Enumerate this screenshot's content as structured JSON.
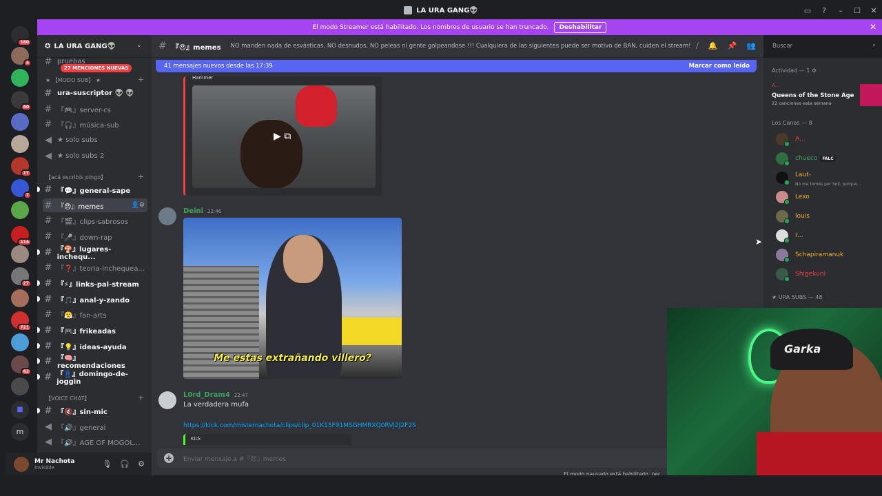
{
  "window": {
    "title": "LA URA GANG👽"
  },
  "streamer_bar": {
    "message": "El modo Streamer está habilitado. Los nombres de usuario se han truncado.",
    "button": "Deshabilitar"
  },
  "server_badges": [
    "160",
    "5",
    "80",
    "",
    "",
    "17",
    "7",
    "",
    "114",
    "",
    "27",
    "",
    "721",
    "",
    "62",
    "",
    ""
  ],
  "guild": {
    "name": "LA URA GANG👽",
    "mentions": "27 MENCIONES NUEVAS"
  },
  "categories": {
    "modo_sub": "【MODO SUB】",
    "aca": "【acá escribís pingo】",
    "voice": "【VOICE CHAT】"
  },
  "channels": [
    {
      "name": "pruebas"
    },
    {
      "name": "ura-suscriptor 👽 👽"
    },
    {
      "name": "『🎮』server-cs"
    },
    {
      "name": "『🎧』música-sub"
    },
    {
      "name": "★ solo subs"
    },
    {
      "name": "★ solo subs 2"
    },
    {
      "name": "『💬』general-sape"
    },
    {
      "name": "『😠』memes"
    },
    {
      "name": "『🎬』clips-sabrosos"
    },
    {
      "name": "『🎤』down-rap"
    },
    {
      "name": "『🍄』lugares-inchequ..."
    },
    {
      "name": "『❓』teoria-inchequea..."
    },
    {
      "name": "『⚡』links-pal-stream"
    },
    {
      "name": "『🎵』anal-y-zando"
    },
    {
      "name": "『😤』fan-arts"
    },
    {
      "name": "『🎮』frikeadas"
    },
    {
      "name": "『💡』ideas-ayuda"
    },
    {
      "name": "『🧠』recomendaciones"
    },
    {
      "name": "『👖』domingo-de-joggin"
    },
    {
      "name": "『🔇』sin-mic"
    },
    {
      "name": "『🔊』general"
    },
    {
      "name": "『🔊』AGE OF MOGOL..."
    }
  ],
  "user": {
    "name": "Mr Nachota",
    "status": "Invisible"
  },
  "header": {
    "channel": "『😠』memes",
    "topic": "NO manden nada de esvásticas, NO desnudos, NO peleas ni gente golpeandose !!! Cualquiera de las siguientes puede ser motivo de BAN, cuiden el stream!"
  },
  "new_messages": {
    "text": "41 mensajes nuevos desde las 17:39",
    "mark": "Marcar como leído"
  },
  "embed_author": "Hammer",
  "messages": [
    {
      "author": "Deini",
      "time": "22:46",
      "text": "",
      "color": "#3ba55c",
      "caption": "Me estas extrañando villero?"
    },
    {
      "author": "L0rd_Dram4",
      "time": "22:47",
      "text": "La verdadera mufa",
      "color": "#3ba55c"
    }
  ],
  "link": {
    "url": "https://kick.com/misternachota/clips/clip_01K15F91MSGHMRXQ0RVJ2J2F2S",
    "provider": "Kick"
  },
  "composer": {
    "placeholder": "Enviar mensaje a #『😠』memes"
  },
  "footer_note": "El modo pausado está habilitado. per",
  "search": {
    "placeholder": "Buscar"
  },
  "members": {
    "activity_header": "Actividad — 1",
    "activity": {
      "user": "A...",
      "title": "Queens of the Stone Age",
      "sub": "22 canciones esta semana"
    },
    "group1": "Los Canas — 8",
    "list": [
      {
        "name": "A...",
        "color": "#f23f42",
        "sub": ""
      },
      {
        "name": "chueco",
        "color": "#3ba55c",
        "sub": "",
        "badge": "FALC"
      },
      {
        "name": "Laut-",
        "color": "#f0b232",
        "sub": "No me tomés por Soli, porque..."
      },
      {
        "name": "Lexo",
        "color": "#f0b232",
        "sub": ""
      },
      {
        "name": "louis",
        "color": "#f0b232",
        "sub": ""
      },
      {
        "name": "r...",
        "color": "#f0b232",
        "sub": ""
      },
      {
        "name": "Schapiramanuk",
        "color": "#f0b232",
        "sub": ""
      },
      {
        "name": "Shigekuni",
        "color": "#f23f42",
        "sub": ""
      }
    ],
    "group2": "★ URA SUBS — 48"
  },
  "webcam": {
    "hat_text": "Garka"
  },
  "colors": {
    "accent": "#5865f2",
    "streamer": "#a544f0",
    "link": "#00a8fc"
  }
}
